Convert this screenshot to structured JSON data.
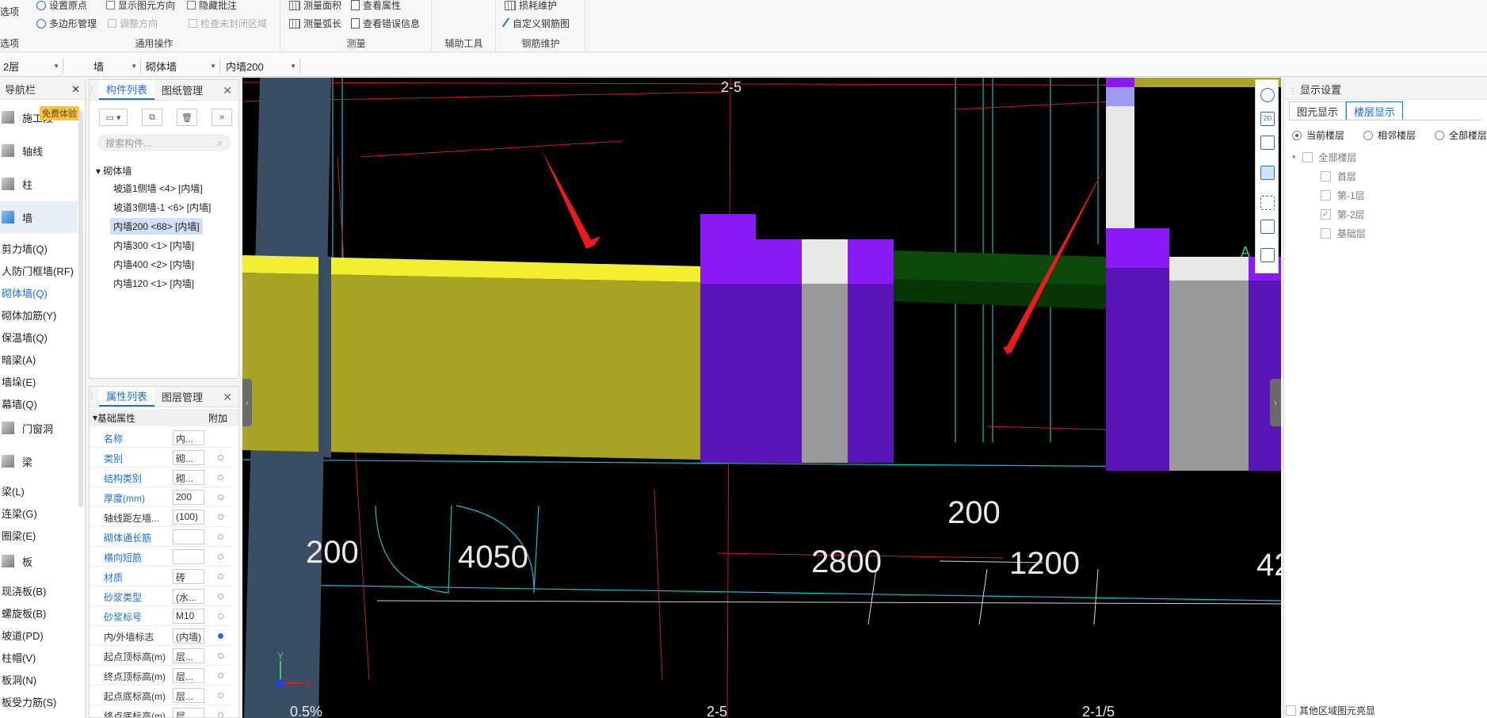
{
  "ribbon": {
    "left_labels": [
      "选项",
      "选项"
    ],
    "groups": [
      {
        "title": "通用操作",
        "items": [
          "设置原点",
          "显示图元方向",
          "隐藏批注",
          "多边形管理",
          "调整方向",
          "检查未封闭区域"
        ]
      },
      {
        "title": "测量",
        "items": [
          "测量面积",
          "查看属性",
          "测量弧长",
          "查看错误信息"
        ]
      },
      {
        "title": "辅助工具",
        "items": []
      },
      {
        "title": "钢筋维护",
        "items": [
          "损耗维护",
          "自定义钢筋图"
        ]
      }
    ]
  },
  "selectors": [
    "2层",
    "墙",
    "砌体墙",
    "内墙200"
  ],
  "nav": {
    "title": "导航栏",
    "badge": "免费体验",
    "items": [
      "施工段",
      "轴线",
      "柱",
      "墙",
      "门窗洞",
      "梁",
      "板"
    ],
    "sub_wall": [
      "剪力墙(Q)",
      "人防门框墙(RF)",
      "砌体墙(Q)",
      "砌体加筋(Y)",
      "保温墙(Q)",
      "暗梁(A)",
      "墙垛(E)",
      "幕墙(Q)"
    ],
    "sub_beam": [
      "梁(L)",
      "连梁(G)",
      "圈梁(E)"
    ],
    "sub_slab": [
      "现浇板(B)",
      "螺旋板(B)",
      "坡道(PD)",
      "柱帽(V)",
      "板洞(N)",
      "板受力筋(S)"
    ]
  },
  "components": {
    "tabs": [
      "构件列表",
      "图纸管理"
    ],
    "search_placeholder": "搜索构件...",
    "root": "砌体墙",
    "items": [
      "坡道1侧墙 <4> [内墙]",
      "坡道3侧墙-1 <6> [内墙]",
      "内墙200 <68> [内墙]",
      "内墙300 <1> [内墙]",
      "内墙400 <2> [内墙]",
      "内墙120 <1> [内墙]"
    ],
    "selected_index": 2
  },
  "properties": {
    "tabs": [
      "属性列表",
      "图层管理"
    ],
    "section": "基础属性",
    "extra_col": "附加",
    "rows": [
      {
        "name": "名称",
        "value": "内...",
        "blue": true
      },
      {
        "name": "类别",
        "value": "砌...",
        "blue": true
      },
      {
        "name": "结构类别",
        "value": "砌...",
        "blue": true
      },
      {
        "name": "厚度(mm)",
        "value": "200",
        "blue": true
      },
      {
        "name": "轴线距左墙...",
        "value": "(100)",
        "blue": false
      },
      {
        "name": "砌体通长筋",
        "value": "",
        "blue": true
      },
      {
        "name": "横向短筋",
        "value": "",
        "blue": true
      },
      {
        "name": "材质",
        "value": "砖",
        "blue": true
      },
      {
        "name": "砂浆类型",
        "value": "(水...",
        "blue": true
      },
      {
        "name": "砂浆标号",
        "value": "M10",
        "blue": true
      },
      {
        "name": "内/外墙标志",
        "value": "(内墙)",
        "blue": false,
        "checked": true
      },
      {
        "name": "起点顶标高(m)",
        "value": "层...",
        "blue": false
      },
      {
        "name": "终点顶标高(m)",
        "value": "层...",
        "blue": false
      },
      {
        "name": "起点底标高(m)",
        "value": "层...",
        "blue": false
      },
      {
        "name": "终点底标高(m)",
        "value": "层...",
        "blue": false
      }
    ]
  },
  "canvas": {
    "dims": [
      "200",
      "4050",
      "2800",
      "1200",
      "200",
      "42"
    ],
    "axis_labels": [
      "2-5",
      "2-5",
      "2-1/5",
      "A",
      "0.5%"
    ],
    "axes": [
      "Y",
      "X"
    ]
  },
  "display": {
    "title": "显示设置",
    "tabs": [
      "图元显示",
      "楼层显示"
    ],
    "radios": [
      "当前楼层",
      "相邻楼层",
      "全部楼层"
    ],
    "tree_root": "全部楼层",
    "floors": [
      {
        "name": "首层",
        "checked": false
      },
      {
        "name": "第-1层",
        "checked": false
      },
      {
        "name": "第-2层",
        "checked": true
      },
      {
        "name": "基础层",
        "checked": false
      }
    ],
    "footer": "其他区域图元亮显"
  },
  "colors": {
    "accent": "#1e6fd0",
    "wall_yellow": "#a9a325",
    "wall_purple": "#5b14b8",
    "wall_green": "#0c4a0c"
  }
}
